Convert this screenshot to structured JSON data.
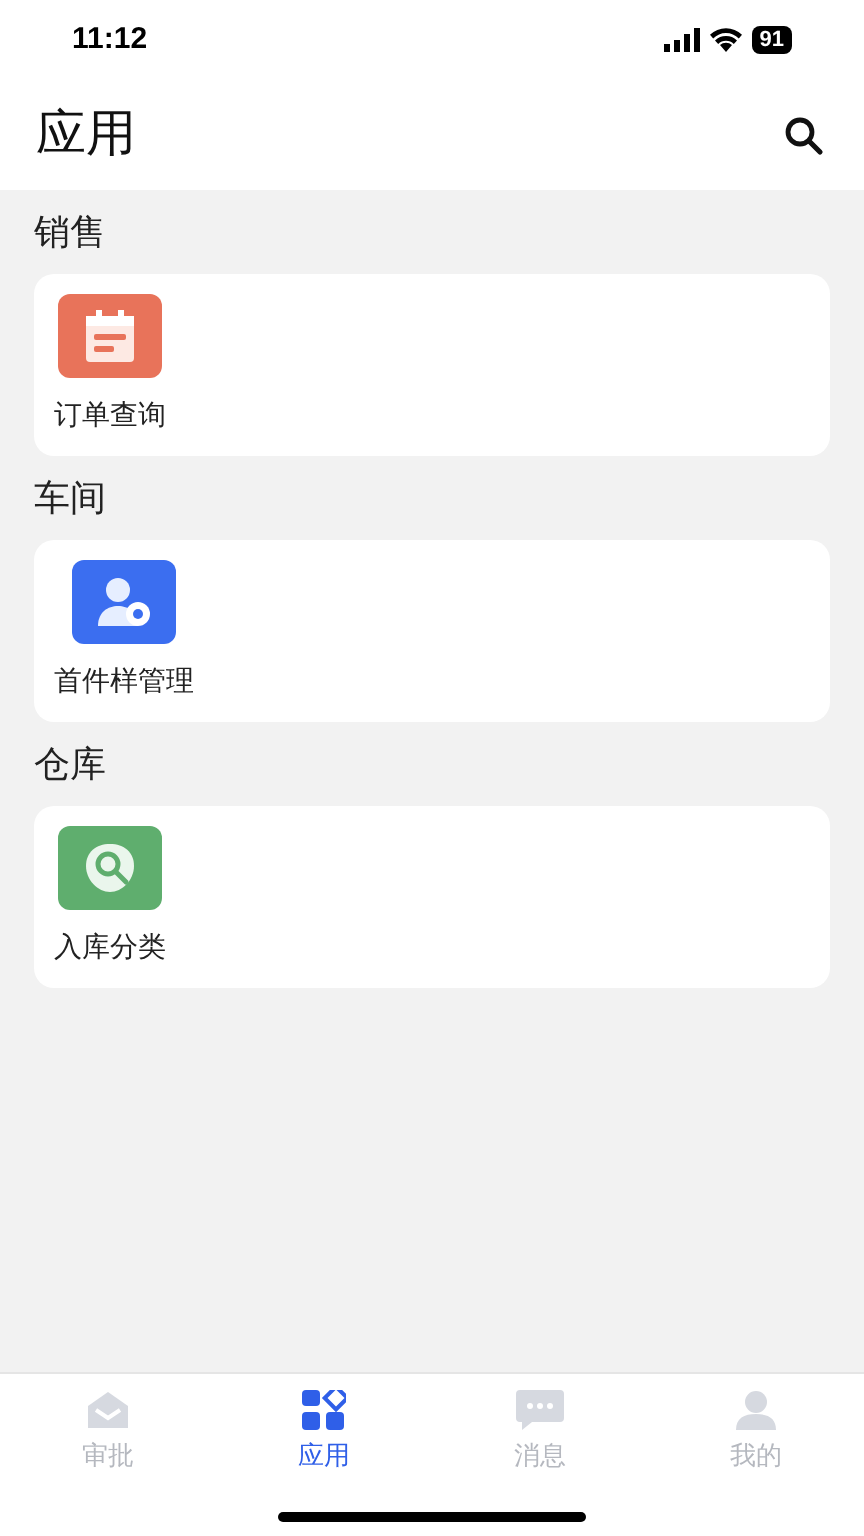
{
  "status_bar": {
    "time": "11:12",
    "battery": "91"
  },
  "header": {
    "title": "应用"
  },
  "sections": [
    {
      "title": "销售",
      "apps": [
        {
          "label": "订单查询",
          "kind": "calendar",
          "color": "#e8735a"
        }
      ]
    },
    {
      "title": "车间",
      "apps": [
        {
          "label": "首件样管理",
          "kind": "user-gear",
          "color": "#3b6ef0"
        }
      ]
    },
    {
      "title": "仓库",
      "apps": [
        {
          "label": "入库分类",
          "kind": "search-badge",
          "color": "#5fae6e"
        }
      ]
    }
  ],
  "tab_bar": [
    {
      "label": "审批",
      "kind": "mail",
      "selected": false
    },
    {
      "label": "应用",
      "kind": "apps",
      "selected": true
    },
    {
      "label": "消息",
      "kind": "chat",
      "selected": false
    },
    {
      "label": "我的",
      "kind": "person",
      "selected": false
    }
  ]
}
